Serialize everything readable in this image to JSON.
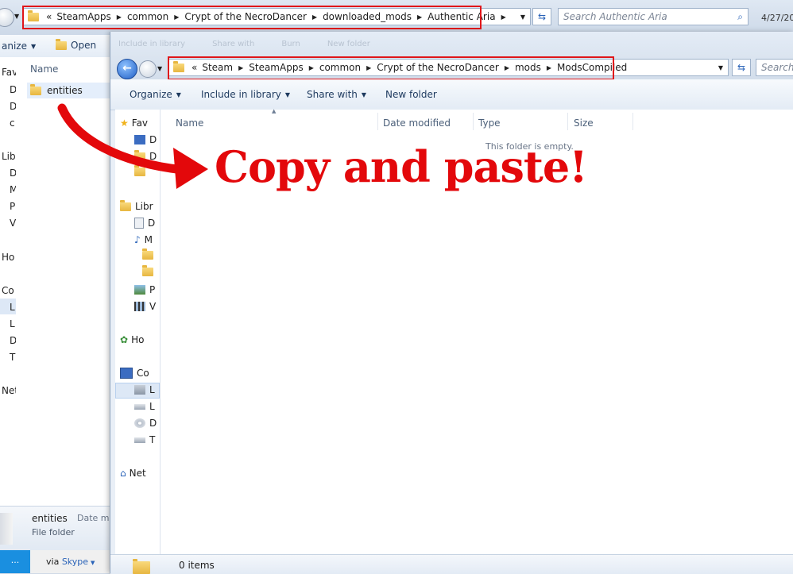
{
  "back_window": {
    "breadcrumb": [
      "«",
      "SteamApps",
      "common",
      "Crypt of the NecroDancer",
      "downloaded_mods",
      "Authentic Aria"
    ],
    "search_placeholder": "Search Authentic Aria",
    "date_partial": "4/27/20",
    "toolbar": {
      "organize": "anize",
      "open": "Open"
    },
    "column_name": "Name",
    "nav_items": [
      "Fav",
      "D",
      "D",
      "c",
      "Lib",
      "D",
      "M",
      "P",
      "V",
      "Ho",
      "Co",
      "L",
      "L",
      "D",
      "T",
      "Net"
    ],
    "items": [
      {
        "name": "entities"
      }
    ],
    "details": {
      "name": "entities",
      "type": "File folder",
      "date_label": "Date m"
    },
    "status": {
      "via": "via",
      "skype": "Skype",
      "left": "..."
    }
  },
  "front_window": {
    "faded_toolbar": [
      "Include in library",
      "Share with",
      "Burn",
      "New folder"
    ],
    "breadcrumb": [
      "«",
      "Steam",
      "SteamApps",
      "common",
      "Crypt of the NecroDancer",
      "mods",
      "ModsCompiled"
    ],
    "search_placeholder": "Search",
    "command_bar": {
      "organize": "Organize",
      "include": "Include in library",
      "share": "Share with",
      "new_folder": "New folder"
    },
    "columns": [
      "Name",
      "Date modified",
      "Type",
      "Size"
    ],
    "empty_message": "This folder is empty.",
    "nav": {
      "favorites": "Fav",
      "f1": "D",
      "f2": "D",
      "f3": "",
      "libraries": "Libr",
      "l1": "D",
      "l2": "M",
      "l3": "",
      "l4": "",
      "l5": "P",
      "l6": "V",
      "homegroup": "Ho",
      "computer": "Co",
      "c1": "L",
      "c2": "L",
      "c3": "D",
      "c4": "T",
      "network": "Net"
    },
    "status_count": "0 items"
  },
  "annotation": {
    "text": "Copy and paste!",
    "color": "#e3080b"
  }
}
